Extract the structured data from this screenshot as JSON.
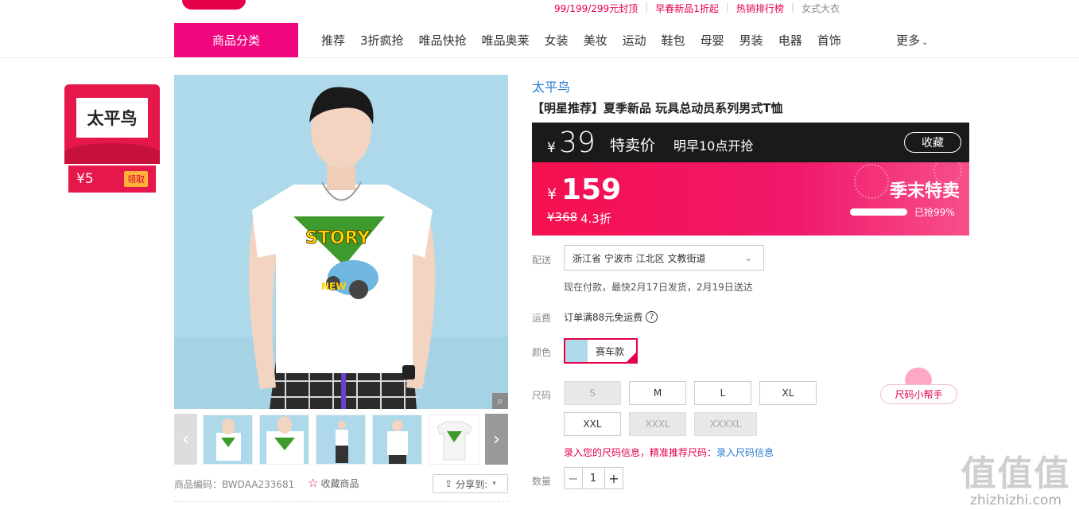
{
  "promo_links": {
    "items": [
      "99/199/299元封顶",
      "早春新品1折起",
      "热销排行榜",
      "女式大衣"
    ],
    "separator": "|"
  },
  "nav": {
    "category_button": "商品分类",
    "items": [
      "推荐",
      "3折疯抢",
      "唯品快抢",
      "唯品奥莱",
      "女装",
      "美妆",
      "运动",
      "鞋包",
      "母婴",
      "男装",
      "电器",
      "首饰"
    ],
    "more": "更多"
  },
  "shop": {
    "name": "太平鸟",
    "coupon_value": "¥5",
    "coupon_action": "领取"
  },
  "gallery": {
    "zoom_icon": "magnifier-icon",
    "prev": "‹",
    "next": "›",
    "product_code": "商品编码：BWDAA233681",
    "favorite_product": "收藏商品",
    "share": "分享到:",
    "shirt_print": "STORY",
    "shirt_print_sub": "NEW"
  },
  "product": {
    "brand": "太平鸟",
    "title": "【明星推荐】夏季新品 玩具总动员系列男式T恤",
    "special_price_symbol": "¥",
    "special_price": "39",
    "special_label": "特卖价",
    "special_note": "明早10点开抢",
    "favorite": "收藏",
    "current_price_symbol": "¥",
    "current_price": "159",
    "original_price": "¥368",
    "discount": "4.3折",
    "season_label": "季末特卖",
    "sold_text": "已抢99%",
    "sold_fraction": 0.99
  },
  "delivery": {
    "label": "配送",
    "address": "浙江省 宁波市 江北区 文教街道",
    "note": "现在付款，最快2月17日发货，2月19日送达"
  },
  "freight": {
    "label": "运费",
    "text": "订单满88元免运费",
    "help": "?"
  },
  "color": {
    "label": "颜色",
    "selected": "赛车款"
  },
  "size": {
    "label": "尺码",
    "options": [
      {
        "name": "S",
        "available": false
      },
      {
        "name": "M",
        "available": true
      },
      {
        "name": "L",
        "available": true
      },
      {
        "name": "XL",
        "available": true
      },
      {
        "name": "XXL",
        "available": true
      },
      {
        "name": "XXXL",
        "available": false
      },
      {
        "name": "XXXXL",
        "available": false
      }
    ],
    "helper": "尺码小帮手",
    "tip": "录入您的尺码信息，精准推荐尺码：",
    "tip_link": "录入尺码信息"
  },
  "quantity": {
    "label": "数量",
    "value": "1",
    "minus": "−",
    "plus": "+"
  },
  "watermark": {
    "top": "值值值",
    "bottom": "zhizhizhi.com"
  },
  "colors": {
    "accent": "#e6004a",
    "nav_button": "#f0067f",
    "link": "#2a7fd4"
  }
}
